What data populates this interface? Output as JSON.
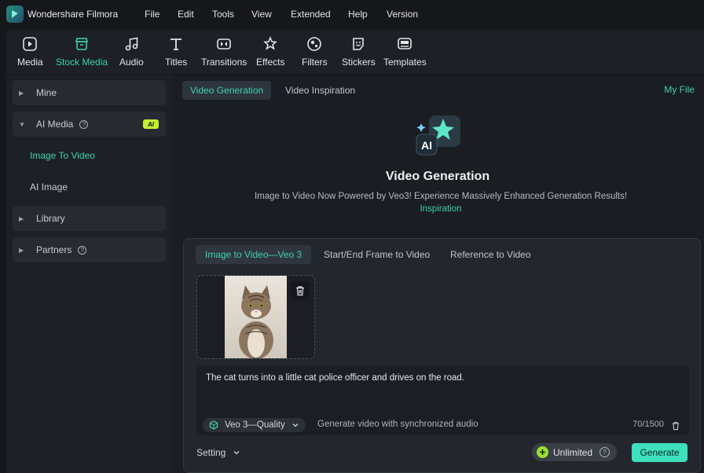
{
  "titlebar": {
    "app_title": "Wondershare Filmora",
    "menu": [
      "File",
      "Edit",
      "Tools",
      "View",
      "Extended",
      "Help",
      "Version"
    ]
  },
  "toolbar": {
    "items": [
      {
        "label": "Media",
        "icon": "media-icon"
      },
      {
        "label": "Stock Media",
        "icon": "stock-media-icon",
        "active": true
      },
      {
        "label": "Audio",
        "icon": "audio-icon"
      },
      {
        "label": "Titles",
        "icon": "titles-icon"
      },
      {
        "label": "Transitions",
        "icon": "transitions-icon"
      },
      {
        "label": "Effects",
        "icon": "effects-icon"
      },
      {
        "label": "Filters",
        "icon": "filters-icon"
      },
      {
        "label": "Stickers",
        "icon": "stickers-icon"
      },
      {
        "label": "Templates",
        "icon": "templates-icon"
      }
    ]
  },
  "sidebar": {
    "mine": "Mine",
    "ai_media": "AI Media",
    "ai_badge": "AI",
    "image_to_video": "Image To Video",
    "ai_image": "AI Image",
    "library": "Library",
    "partners": "Partners"
  },
  "main": {
    "tabs": [
      "Video Generation",
      "Video Inspiration"
    ],
    "my_file": "My File",
    "hero_title": "Video Generation",
    "hero_subtitle": "Image to Video Now Powered by Veo3! Experience Massively Enhanced Generation Results!",
    "hero_link": "Inspiration",
    "panel": {
      "tabs": [
        "Image to Video—Veo 3",
        "Start/End Frame to Video",
        "Reference to Video"
      ],
      "prompt": "The cat turns into a little cat police officer and drives on the road.",
      "model": "Veo 3—Quality",
      "model_note": "Generate video with synchronized audio",
      "counter": "70/1500",
      "setting": "Setting",
      "unlimited": "Unlimited",
      "generate": "Generate"
    }
  },
  "colors": {
    "accent": "#3ed1b2",
    "ai_badge": "#c4f032",
    "generate_button": "#3fe0be"
  }
}
